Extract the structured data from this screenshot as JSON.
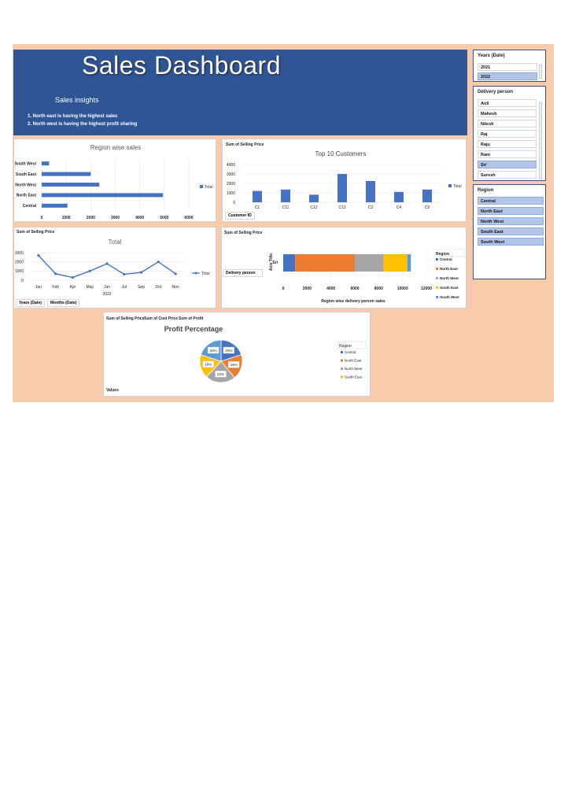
{
  "header": {
    "title": "Sales Dashboard",
    "subtitle": "Sales insights",
    "insights": [
      "1. North east is having the highest sales",
      "2. North west is having the highest profit sharing"
    ]
  },
  "region_chart": {
    "title": "Region wise sales",
    "legend": "Total",
    "chart_data": {
      "type": "bar",
      "orientation": "horizontal",
      "categories": [
        "Central",
        "North East",
        "North West",
        "South East",
        "South West"
      ],
      "values": [
        1050,
        4950,
        2350,
        2000,
        300
      ],
      "xlim": [
        0,
        6000
      ],
      "xticks": [
        "0",
        "1000",
        "2000",
        "3000",
        "4000",
        "5000",
        "6000"
      ],
      "legend": "Total"
    }
  },
  "customers_chart": {
    "tag": "Sum of Selling Price",
    "title": "Top 10 Customers",
    "legend": "Total",
    "field_button": "Customer ID",
    "chart_data": {
      "type": "bar",
      "categories": [
        "C1",
        "C11",
        "C12",
        "C13",
        "C3",
        "C4",
        "C9"
      ],
      "values": [
        1200,
        1350,
        800,
        3000,
        2250,
        1100,
        1350
      ],
      "ylim": [
        0,
        4000
      ],
      "yticks": [
        "0",
        "1000",
        "2000",
        "3000",
        "4000"
      ],
      "legend": "Total"
    }
  },
  "monthly_chart": {
    "tag": "Sum of Selling Price",
    "title": "Total",
    "legend": "Total",
    "year_label": "2022",
    "field_buttons": [
      "Years (Date)",
      "Months (Date)"
    ],
    "chart_data": {
      "type": "line",
      "categories": [
        "Jan",
        "Feb",
        "Apr",
        "May",
        "Jun",
        "Jul",
        "Sep",
        "Oct",
        "Nov"
      ],
      "values": [
        2700,
        700,
        300,
        1000,
        1800,
        650,
        850,
        2000,
        700
      ],
      "ylim": [
        0,
        3000
      ],
      "yticks": [
        "0",
        "1000",
        "2000",
        "3000"
      ],
      "xlabel": "2022",
      "legend": "Total"
    }
  },
  "delivery_chart": {
    "tag": "Sum of Selling Price",
    "axis_title": "Axis Title",
    "xlabel": "Region wise delivery person sales",
    "field_button": "Delivery person",
    "legend_title": "Region",
    "chart_data": {
      "type": "bar",
      "orientation": "horizontal-stacked",
      "categories": [
        "Sri"
      ],
      "series": [
        {
          "name": "Central",
          "values": [
            1000
          ],
          "color": "#4472c4"
        },
        {
          "name": "North East",
          "values": [
            5000
          ],
          "color": "#ed7d31"
        },
        {
          "name": "North West",
          "values": [
            2400
          ],
          "color": "#a5a5a5"
        },
        {
          "name": "South East",
          "values": [
            2000
          ],
          "color": "#ffc000"
        },
        {
          "name": "South West",
          "values": [
            300
          ],
          "color": "#5b9bd5"
        }
      ],
      "xlim": [
        0,
        12000
      ],
      "xticks": [
        "0",
        "2000",
        "4000",
        "6000",
        "8000",
        "10000",
        "12000"
      ],
      "xlabel": "Region wise delivery person sales",
      "ylabel": "Axis Title"
    }
  },
  "profit_chart": {
    "tags": [
      "Sum of Selling Price",
      "Sum of Cost Price",
      "Sum of Profit"
    ],
    "title": "Profit Percentage",
    "legend_title": "Region",
    "field_button": "Values",
    "chart_data": {
      "type": "pie",
      "categories": [
        "Central",
        "North East",
        "North West",
        "South East",
        "South West"
      ],
      "values": [
        20,
        19,
        23,
        18,
        20
      ],
      "labels": [
        "20%",
        "19%",
        "23%",
        "18%",
        "20%"
      ],
      "colors": [
        "#4472c4",
        "#ed7d31",
        "#a5a5a5",
        "#ffc000",
        "#5b9bd5"
      ],
      "legend": [
        "Central",
        "North East",
        "North West",
        "South East"
      ]
    }
  },
  "slicers": {
    "years": {
      "title": "Years (Date)",
      "items": [
        "2021",
        "2022"
      ]
    },
    "delivery": {
      "title": "Delivery person",
      "items": [
        "Anil",
        "Mahesh",
        "Nilesh",
        "Raj",
        "Raju",
        "Ram",
        "Sri",
        "Suresh"
      ]
    },
    "region": {
      "title": "Region",
      "items": [
        "Central",
        "North East",
        "North West",
        "South East",
        "South West"
      ]
    }
  }
}
